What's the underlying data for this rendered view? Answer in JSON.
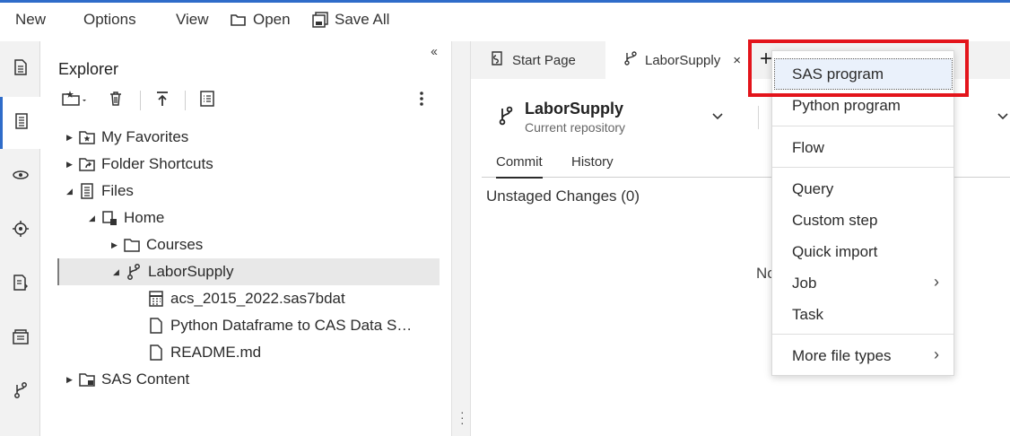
{
  "menubar": {
    "new_label": "New",
    "options_label": "Options",
    "view_label": "View",
    "open_label": "Open",
    "save_all_label": "Save All"
  },
  "rail": {
    "items": [
      "document-icon",
      "explorer-icon",
      "libraries-icon",
      "steps-icon",
      "snippets-icon",
      "clinical-icon",
      "git-icon"
    ],
    "active_index": 1
  },
  "explorer": {
    "title": "Explorer",
    "collapse_label": "‹‹",
    "tree": [
      {
        "label": "My Favorites",
        "icon": "favorites-folder-icon",
        "expanded": false
      },
      {
        "label": "Folder Shortcuts",
        "icon": "shortcut-folder-icon",
        "expanded": false
      },
      {
        "label": "Files",
        "icon": "files-icon",
        "expanded": true
      },
      {
        "label": "Home",
        "icon": "home-folder-icon",
        "expanded": true
      },
      {
        "label": "Courses",
        "icon": "folder-icon",
        "expanded": false
      },
      {
        "label": "LaborSupply",
        "icon": "git-repo-icon",
        "expanded": true,
        "selected": true
      },
      {
        "label": "acs_2015_2022.sas7bdat",
        "icon": "dataset-icon"
      },
      {
        "label": "Python Dataframe to CAS Data S…",
        "icon": "file-icon"
      },
      {
        "label": "README.md",
        "icon": "file-icon"
      },
      {
        "label": "SAS Content",
        "icon": "sas-content-icon",
        "expanded": false
      }
    ]
  },
  "tabs": [
    {
      "label": "Start Page",
      "icon": "start-page-icon"
    },
    {
      "label": "LaborSupply",
      "icon": "git-branch-icon",
      "active": true,
      "close": "×"
    }
  ],
  "new_tab_label": "+",
  "repo": {
    "name": "LaborSupply",
    "subtitle": "Current repository"
  },
  "subtabs": [
    "Commit",
    "History"
  ],
  "unstaged_label": "Unstaged Changes (0)",
  "partial_text": "No",
  "dropdown": {
    "items": [
      {
        "label": "SAS program",
        "focused": true
      },
      {
        "label": "Python program"
      },
      {
        "label": "Flow"
      },
      {
        "label": "Query"
      },
      {
        "label": "Custom step"
      },
      {
        "label": "Quick import"
      },
      {
        "label": "Job",
        "submenu": "›"
      },
      {
        "label": "Task"
      },
      {
        "label": "More file types",
        "submenu": "›"
      }
    ]
  },
  "colors": {
    "accent": "#2f6cc9",
    "highlight_border": "#e3141b",
    "rail_bg": "#f2f2f2"
  }
}
